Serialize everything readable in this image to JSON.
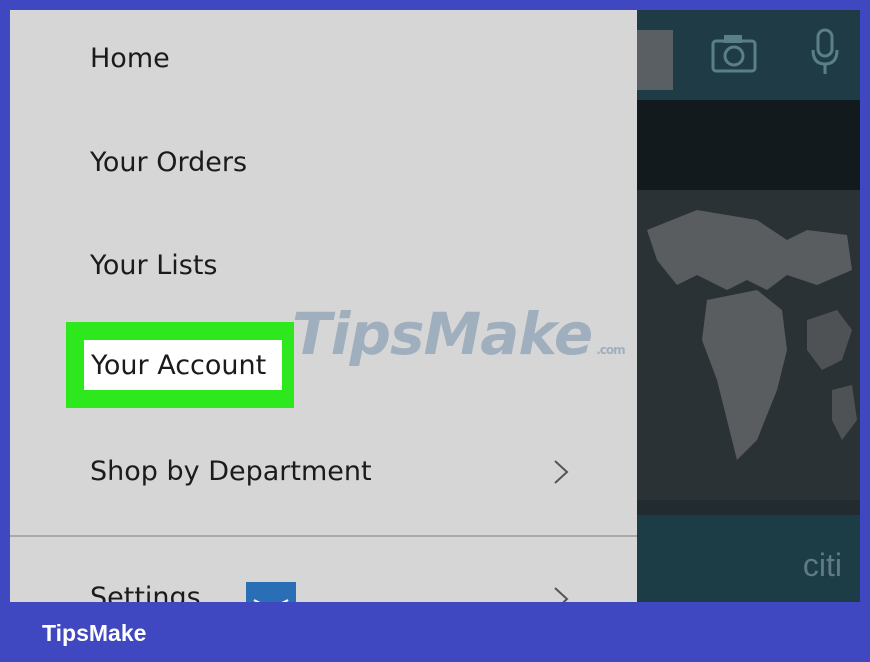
{
  "menu": {
    "items": [
      {
        "label": "Home"
      },
      {
        "label": "Your Orders"
      },
      {
        "label": "Your Lists"
      },
      {
        "label": "Your Account",
        "highlighted": true
      },
      {
        "label": "Shop by Department",
        "has_submenu": true
      },
      {
        "label": "Settings",
        "has_submenu": true
      }
    ]
  },
  "background": {
    "banner_text": "citi",
    "icons": [
      "camera-icon",
      "microphone-icon"
    ]
  },
  "watermark": {
    "text": "TipsMake",
    "suffix": ".com"
  },
  "footer": {
    "brand": "TipsMake"
  },
  "colors": {
    "highlight": "#2de81d",
    "drawer": "#d6d6d6",
    "frame": "#3f48c0"
  }
}
